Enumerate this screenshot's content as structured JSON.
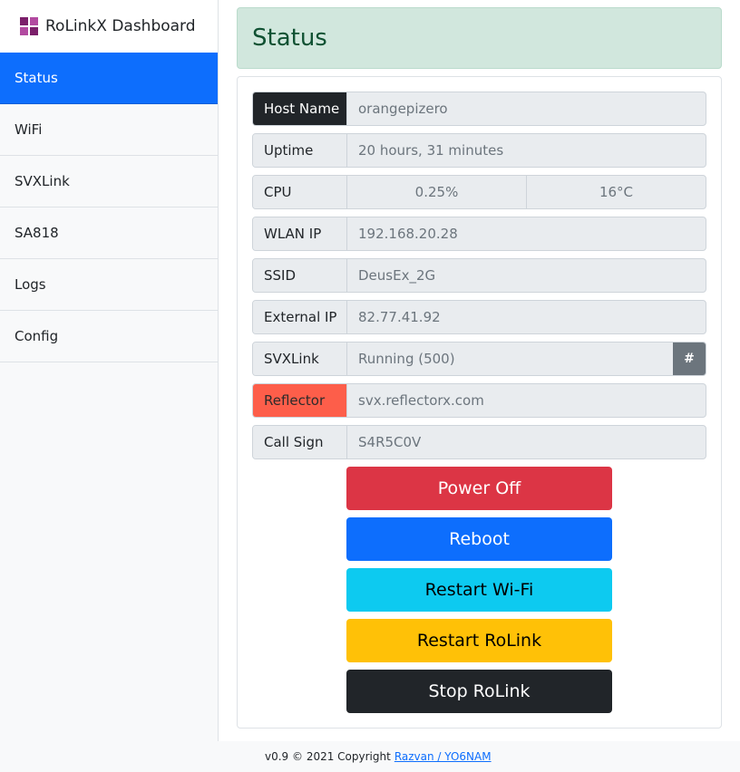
{
  "brand": {
    "title": "RoLinkX Dashboard"
  },
  "nav": {
    "items": [
      {
        "label": "Status",
        "active": true
      },
      {
        "label": "WiFi"
      },
      {
        "label": "SVXLink"
      },
      {
        "label": "SA818"
      },
      {
        "label": "Logs"
      },
      {
        "label": "Config"
      }
    ]
  },
  "page": {
    "title": "Status"
  },
  "status": {
    "host_name": {
      "label": "Host Name",
      "value": "orangepizero"
    },
    "uptime": {
      "label": "Uptime",
      "value": "20 hours, 31 minutes"
    },
    "cpu": {
      "label": "CPU",
      "load": "0.25%",
      "temp": "16°C"
    },
    "wlan_ip": {
      "label": "WLAN IP",
      "value": "192.168.20.28"
    },
    "ssid": {
      "label": "SSID",
      "value": "DeusEx_2G"
    },
    "external_ip": {
      "label": "External IP",
      "value": "82.77.41.92"
    },
    "svxlink": {
      "label": "SVXLink",
      "value": "Running (500)",
      "button": "#"
    },
    "reflector": {
      "label": "Reflector",
      "value": "svx.reflectorx.com"
    },
    "call_sign": {
      "label": "Call Sign",
      "value": "S4R5C0V"
    }
  },
  "actions": {
    "power_off": "Power Off",
    "reboot": "Reboot",
    "restart_wifi": "Restart Wi-Fi",
    "restart_rolink": "Restart RoLink",
    "stop_rolink": "Stop RoLink"
  },
  "footer": {
    "text": "v0.9 © 2021 Copyright",
    "link": "Razvan / YO6NAM"
  },
  "colors": {
    "primary": "#0d6efd",
    "success_bg": "#d1e7dd",
    "danger": "#dc3545",
    "reflector_label": "#fd5e4a",
    "info": "#0dcaf0",
    "warning": "#ffc107",
    "dark": "#212529"
  }
}
